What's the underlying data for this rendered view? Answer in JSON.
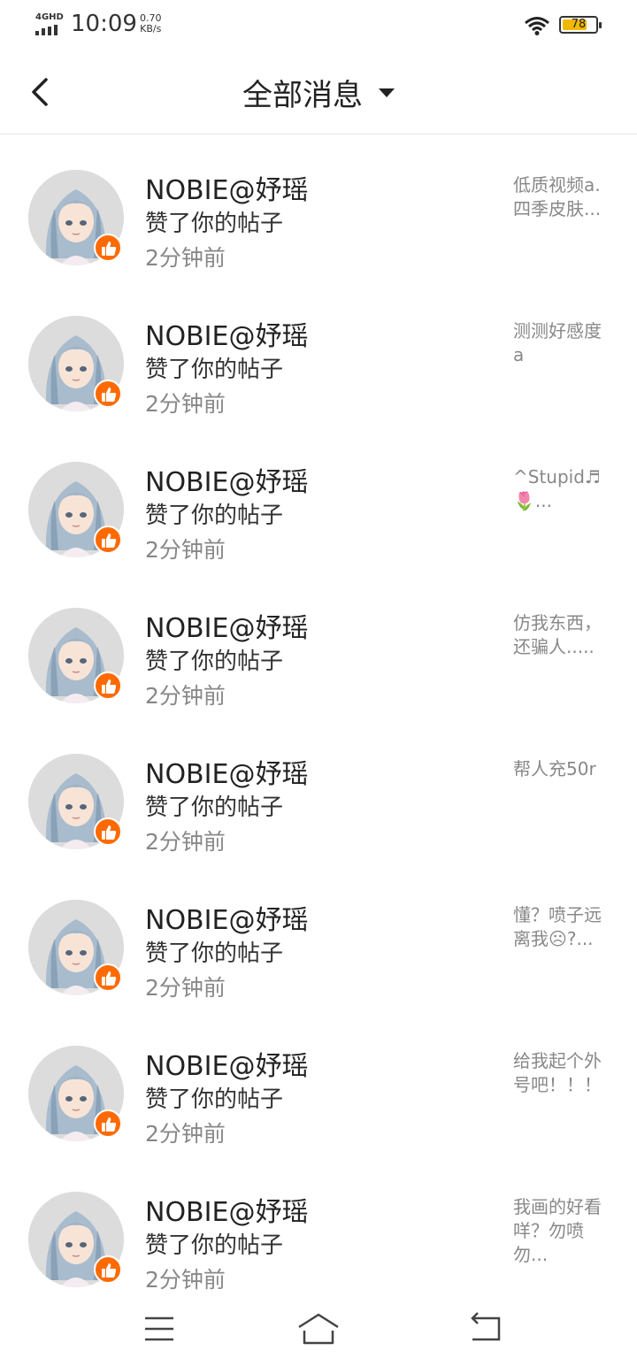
{
  "status_bar": {
    "network": "4GHD",
    "time": "10:09",
    "speed_value": "0.70",
    "speed_unit": "KB/s",
    "battery_level": "78",
    "battery_color": "#f0b800"
  },
  "header": {
    "title": "全部消息"
  },
  "colors": {
    "like_badge": "#ff6a00"
  },
  "messages": [
    {
      "user": "NOBIE@妤瑶",
      "action": "赞了你的帖子",
      "time": "2分钟前",
      "preview": "低质视频a.四季皮肤..."
    },
    {
      "user": "NOBIE@妤瑶",
      "action": "赞了你的帖子",
      "time": "2分钟前",
      "preview": "测测好感度a"
    },
    {
      "user": "NOBIE@妤瑶",
      "action": "赞了你的帖子",
      "time": "2分钟前",
      "preview": "^Stupid♬🌷..."
    },
    {
      "user": "NOBIE@妤瑶",
      "action": "赞了你的帖子",
      "time": "2分钟前",
      "preview": "仿我东西，还骗人....."
    },
    {
      "user": "NOBIE@妤瑶",
      "action": "赞了你的帖子",
      "time": "2分钟前",
      "preview": "帮人充50r"
    },
    {
      "user": "NOBIE@妤瑶",
      "action": "赞了你的帖子",
      "time": "2分钟前",
      "preview": "懂？喷子远离我☹?..."
    },
    {
      "user": "NOBIE@妤瑶",
      "action": "赞了你的帖子",
      "time": "2分钟前",
      "preview": "给我起个外号吧！！！"
    },
    {
      "user": "NOBIE@妤瑶",
      "action": "赞了你的帖子",
      "time": "2分钟前",
      "preview": "我画的好看咩？勿喷勿..."
    }
  ],
  "nav": {
    "icons": [
      "menu-icon",
      "home-icon",
      "back-icon"
    ]
  }
}
